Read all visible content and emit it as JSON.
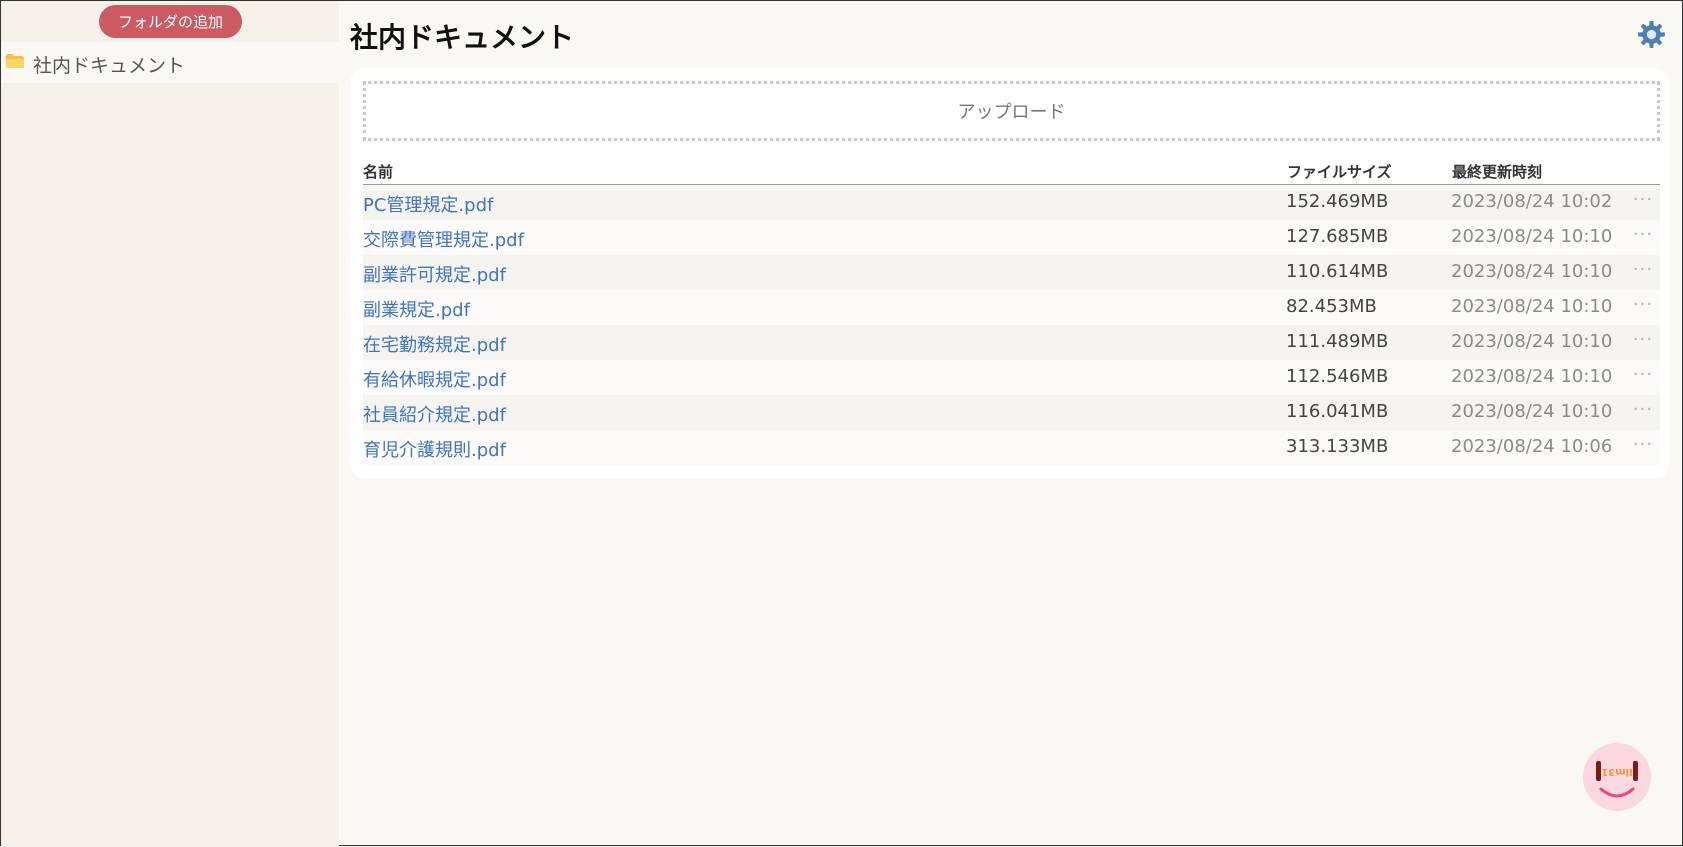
{
  "sidebar": {
    "add_folder_label": "フォルダの追加",
    "folders": [
      {
        "label": "社内ドキュメント",
        "icon": "folder-icon"
      }
    ]
  },
  "header": {
    "title": "社内ドキュメント",
    "settings_icon": "gear-icon"
  },
  "upload": {
    "label": "アップロード"
  },
  "table": {
    "columns": {
      "name": "名前",
      "size": "ファイルサイズ",
      "modified": "最終更新時刻"
    },
    "rows": [
      {
        "name": "PC管理規定.pdf",
        "size": "152.469MB",
        "modified": "2023/08/24 10:02",
        "more": "···"
      },
      {
        "name": "交際費管理規定.pdf",
        "size": "127.685MB",
        "modified": "2023/08/24 10:10",
        "more": "···"
      },
      {
        "name": "副業許可規定.pdf",
        "size": "110.614MB",
        "modified": "2023/08/24 10:10",
        "more": "···"
      },
      {
        "name": "副業規定.pdf",
        "size": "82.453MB",
        "modified": "2023/08/24 10:10",
        "more": "···"
      },
      {
        "name": "在宅勤務規定.pdf",
        "size": "111.489MB",
        "modified": "2023/08/24 10:10",
        "more": "···"
      },
      {
        "name": "有給休暇規定.pdf",
        "size": "112.546MB",
        "modified": "2023/08/24 10:10",
        "more": "···"
      },
      {
        "name": "社員紹介規定.pdf",
        "size": "116.041MB",
        "modified": "2023/08/24 10:10",
        "more": "···"
      },
      {
        "name": "育児介護規則.pdf",
        "size": "313.133MB",
        "modified": "2023/08/24 10:06",
        "more": "···"
      }
    ]
  },
  "mascot": {
    "logo_text": "Ilm31",
    "icon": "smiley-mascot-icon"
  },
  "colors": {
    "accent": "#cc5a63",
    "link": "#3f74c1",
    "sidebar_bg": "#f4f1e8",
    "page_bg": "#f9f8f3"
  }
}
